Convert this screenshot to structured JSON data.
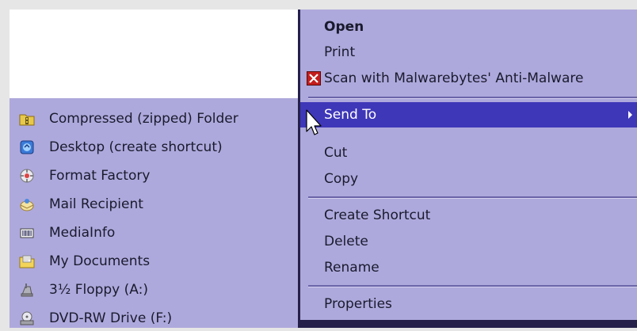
{
  "context_menu": {
    "open": "Open",
    "print": "Print",
    "scan": "Scan with Malwarebytes' Anti-Malware",
    "send_to": "Send To",
    "cut": "Cut",
    "copy": "Copy",
    "create_shortcut": "Create Shortcut",
    "delete": "Delete",
    "rename": "Rename",
    "properties": "Properties"
  },
  "send_to_submenu": {
    "items": [
      {
        "label": "Compressed (zipped) Folder",
        "icon": "zip-folder-icon"
      },
      {
        "label": "Desktop (create shortcut)",
        "icon": "desktop-icon"
      },
      {
        "label": "Format Factory",
        "icon": "format-factory-icon"
      },
      {
        "label": "Mail Recipient",
        "icon": "mail-icon"
      },
      {
        "label": "MediaInfo",
        "icon": "mediainfo-icon"
      },
      {
        "label": "My Documents",
        "icon": "my-documents-icon"
      },
      {
        "label": "3½ Floppy (A:)",
        "icon": "floppy-icon"
      },
      {
        "label": "DVD-RW Drive (F:)",
        "icon": "dvd-drive-icon"
      }
    ]
  },
  "colors": {
    "menu_bg": "#aea9dc",
    "highlight": "#3e37b8",
    "border": "#25204a"
  }
}
